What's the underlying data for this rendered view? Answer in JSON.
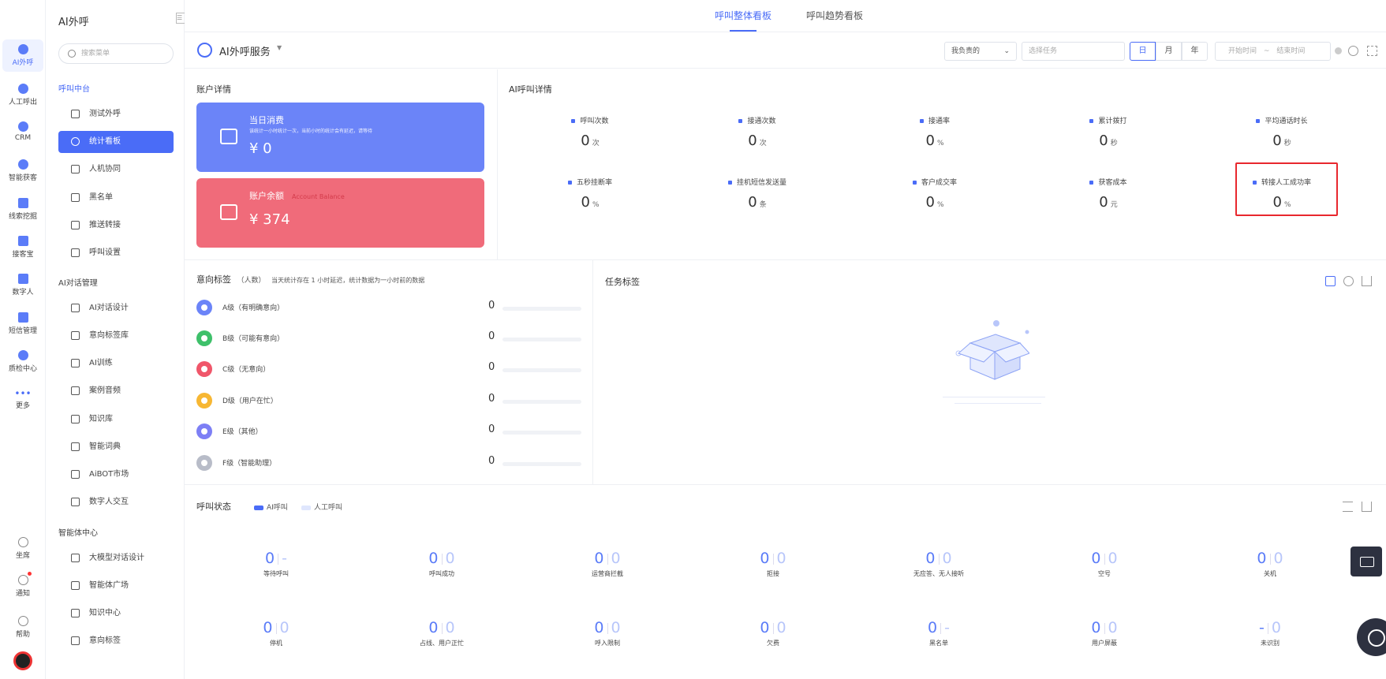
{
  "rail": {
    "items": [
      "AI外呼",
      "人工呼出",
      "CRM",
      "智能获客",
      "线索挖掘",
      "接客宝",
      "数字人",
      "短信管理",
      "质检中心",
      "更多"
    ],
    "bottom": [
      "坐席",
      "通知",
      "帮助"
    ]
  },
  "menu": {
    "title": "AI外呼",
    "search_placeholder": "搜索菜单",
    "groups": [
      {
        "label": "呼叫中台",
        "items": [
          "测试外呼",
          "统计看板",
          "人机协同",
          "黑名单",
          "推送转接",
          "呼叫设置"
        ]
      },
      {
        "label": "AI对话管理",
        "items": [
          "AI对话设计",
          "意向标签库",
          "AI训练",
          "案例音频",
          "知识库",
          "智能词典",
          "AiBOT市场",
          "数字人交互"
        ]
      },
      {
        "label": "智能体中心",
        "items": [
          "大模型对话设计",
          "智能体广场",
          "知识中心",
          "意向标签"
        ]
      }
    ],
    "active_item": "统计看板"
  },
  "tabs": [
    "呼叫整体看板",
    "呼叫趋势看板"
  ],
  "toolbar": {
    "service": "AI外呼服务",
    "owner_select": "我负责的",
    "task_placeholder": "选择任务",
    "periods": [
      "日",
      "月",
      "年"
    ],
    "active_period": "日",
    "start_placeholder": "开始时间",
    "range_sep": "~",
    "end_placeholder": "结束时间"
  },
  "account": {
    "title": "账户详情",
    "daily": {
      "label": "当日消费",
      "note": "该统计一小时统计一次，当前小时的统计会有延迟，请等待",
      "value": "¥ 0"
    },
    "balance": {
      "label": "账户余额",
      "en": "Account Balance",
      "value": "¥ 374"
    }
  },
  "ai_call": {
    "title": "AI呼叫详情",
    "metrics": [
      {
        "label": "呼叫次数",
        "value": "0",
        "unit": "次"
      },
      {
        "label": "接通次数",
        "value": "0",
        "unit": "次"
      },
      {
        "label": "接通率",
        "value": "0",
        "unit": "%"
      },
      {
        "label": "累计拨打",
        "value": "0",
        "unit": "秒"
      },
      {
        "label": "平均通话时长",
        "value": "0",
        "unit": "秒"
      },
      {
        "label": "五秒挂断率",
        "value": "0",
        "unit": "%"
      },
      {
        "label": "挂机短信发送量",
        "value": "0",
        "unit": "条"
      },
      {
        "label": "客户成交率",
        "value": "0",
        "unit": "%"
      },
      {
        "label": "获客成本",
        "value": "0",
        "unit": "元"
      },
      {
        "label": "转接人工成功率",
        "value": "0",
        "unit": "%"
      }
    ]
  },
  "intent": {
    "title": "意向标签",
    "unit": "（人数）",
    "note": "当天统计存在 1 小时延迟，统计数据为一小时前的数据",
    "rows": [
      {
        "label": "A级（有明确意向）",
        "value": "0",
        "color": "#6b84f8"
      },
      {
        "label": "B级（可能有意向）",
        "value": "0",
        "color": "#3ec06a"
      },
      {
        "label": "C级（无意向）",
        "value": "0",
        "color": "#f0566a"
      },
      {
        "label": "D级（用户在忙）",
        "value": "0",
        "color": "#f7b733"
      },
      {
        "label": "E级（其他）",
        "value": "0",
        "color": "#7d7ff5"
      },
      {
        "label": "F级（智能助理）",
        "value": "0",
        "color": "#b8bcc8"
      }
    ]
  },
  "task_tags": {
    "title": "任务标签"
  },
  "call_status": {
    "title": "呼叫状态",
    "legend": [
      "AI呼叫",
      "人工呼叫"
    ],
    "stats": [
      {
        "label": "等待呼叫",
        "ai": "0",
        "human": "-"
      },
      {
        "label": "呼叫成功",
        "ai": "0",
        "human": "0"
      },
      {
        "label": "运营商拦截",
        "ai": "0",
        "human": "0"
      },
      {
        "label": "拒接",
        "ai": "0",
        "human": "0"
      },
      {
        "label": "无应答、无人接听",
        "ai": "0",
        "human": "0"
      },
      {
        "label": "空号",
        "ai": "0",
        "human": "0"
      },
      {
        "label": "关机",
        "ai": "0",
        "human": "0"
      },
      {
        "label": "停机",
        "ai": "0",
        "human": "0"
      },
      {
        "label": "占线、用户正忙",
        "ai": "0",
        "human": "0"
      },
      {
        "label": "呼入限制",
        "ai": "0",
        "human": "0"
      },
      {
        "label": "欠费",
        "ai": "0",
        "human": "0"
      },
      {
        "label": "黑名单",
        "ai": "0",
        "human": "-"
      },
      {
        "label": "用户屏蔽",
        "ai": "0",
        "human": "0"
      },
      {
        "label": "未识别",
        "ai": "-",
        "human": "0"
      }
    ]
  }
}
